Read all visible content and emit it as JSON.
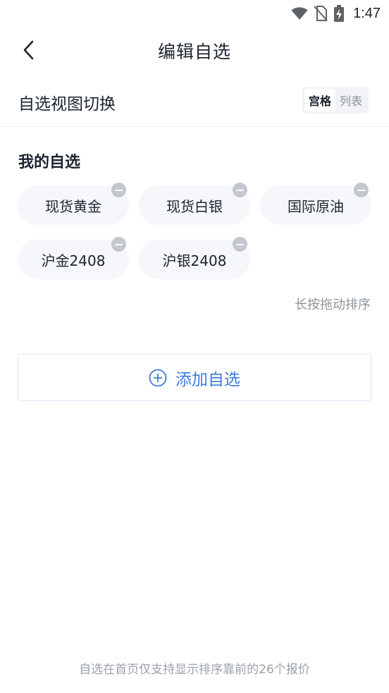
{
  "status_bar": {
    "time": "1:47"
  },
  "header": {
    "title": "编辑自选"
  },
  "view_switch": {
    "label": "自选视图切换",
    "options": [
      {
        "label": "宫格",
        "active": true
      },
      {
        "label": "列表",
        "active": false
      }
    ]
  },
  "watchlist": {
    "title": "我的自选",
    "items": [
      {
        "label": "现货黄金"
      },
      {
        "label": "现货白银"
      },
      {
        "label": "国际原油"
      },
      {
        "label": "沪金2408"
      },
      {
        "label": "沪银2408"
      }
    ],
    "drag_hint": "长按拖动排序"
  },
  "add_button": {
    "label": "添加自选"
  },
  "footer": {
    "note": "自选在首页仅支持显示排序靠前的26个报价"
  },
  "colors": {
    "accent": "#3d7be0",
    "chip_bg": "#f5f7fa",
    "remove_badge": "#c4c8ce"
  }
}
